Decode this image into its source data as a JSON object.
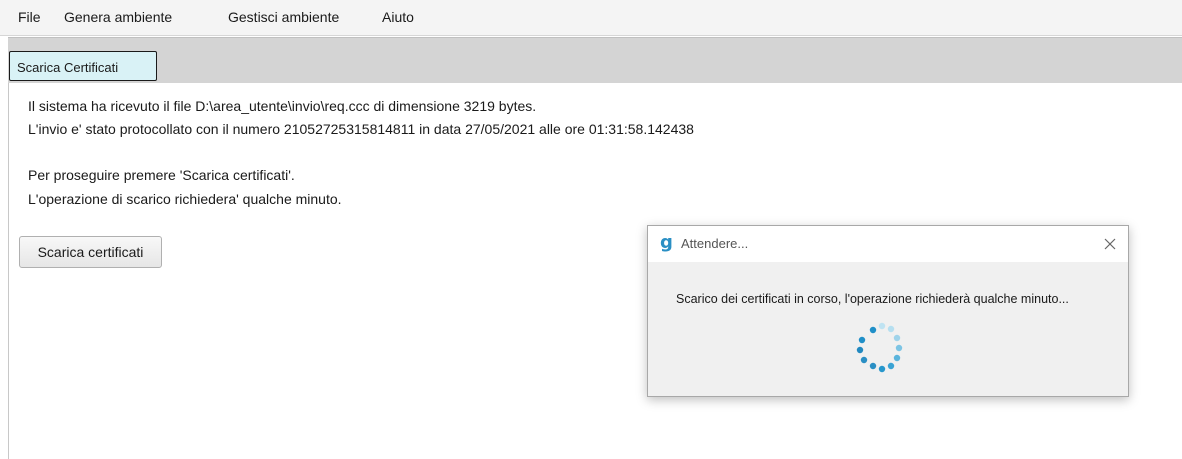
{
  "menubar": {
    "items": [
      "File",
      "Genera ambiente",
      "Gestisci ambiente",
      "Aiuto"
    ]
  },
  "tabs": [
    {
      "label": "Scarica Certificati",
      "active": true
    }
  ],
  "content": {
    "lines": [
      "Il sistema ha ricevuto il file D:\\area_utente\\invio\\req.ccc di dimensione 3219 bytes.",
      "L'invio e' stato protocollato con il numero 21052725315814811 in data 27/05/2021 alle ore 01:31:58.142438",
      "Per proseguire premere 'Scarica certificati'.",
      "L'operazione di scarico richiedera' qualche minuto."
    ],
    "download_button_label": "Scarica certificati"
  },
  "dialog": {
    "logo_glyph": "g",
    "title": "Attendere...",
    "message": "Scarico dei certificati in corso, l'operazione richiederà qualche minuto...",
    "close_icon": "close-icon"
  },
  "colors": {
    "tab_active_bg": "#d9f2f6",
    "accent": "#2a8fc4",
    "spinner_dark": "#1f8fc8",
    "spinner_light": "#bfe3f2"
  }
}
